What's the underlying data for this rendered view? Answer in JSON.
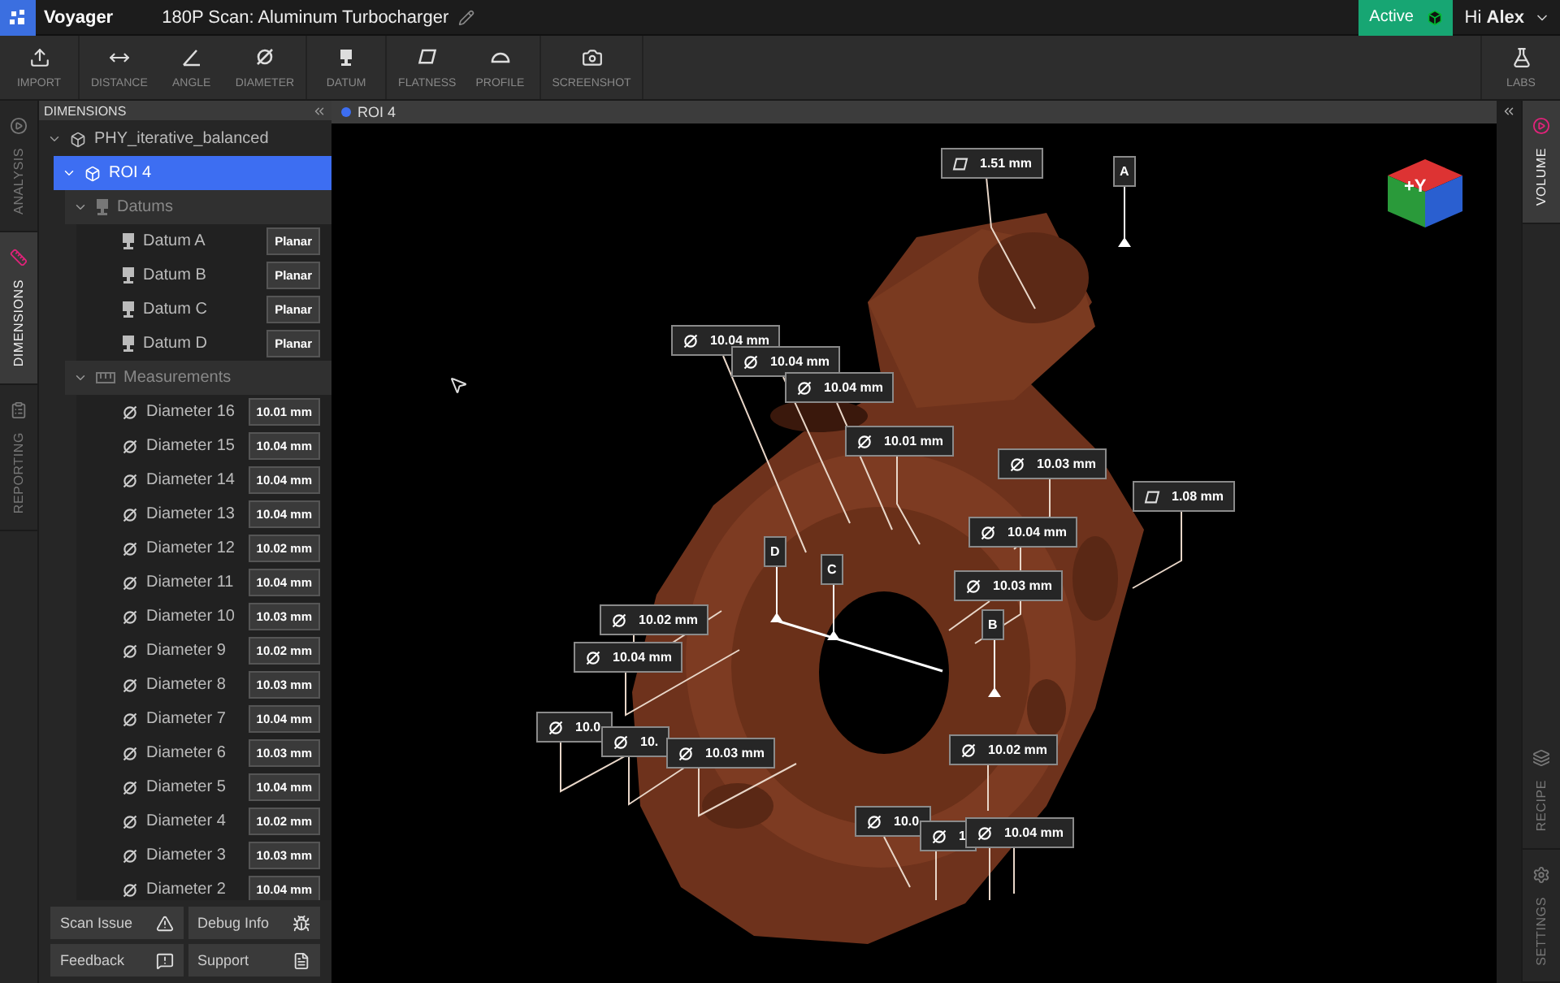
{
  "header": {
    "app_name": "Voyager",
    "title": "180P Scan: Aluminum Turbocharger",
    "status": "Active",
    "greeting": "Hi **Alex**"
  },
  "toolbar": {
    "groups": [
      [
        {
          "label": "IMPORT",
          "kind": "import"
        }
      ],
      [
        {
          "label": "DISTANCE",
          "kind": "distance"
        },
        {
          "label": "ANGLE",
          "kind": "angle"
        },
        {
          "label": "DIAMETER",
          "kind": "diameter"
        }
      ],
      [
        {
          "label": "DATUM",
          "kind": "datum"
        }
      ],
      [
        {
          "label": "FLATNESS",
          "kind": "flatness"
        },
        {
          "label": "PROFILE",
          "kind": "profile"
        }
      ],
      [
        {
          "label": "SCREENSHOT",
          "kind": "screenshot"
        }
      ]
    ],
    "right": {
      "label": "LABS",
      "kind": "labs"
    }
  },
  "left_tabs": [
    {
      "label": "ANALYSIS",
      "kind": "analysis",
      "selected": false
    },
    {
      "label": "DIMENSIONS",
      "kind": "dimensions",
      "selected": true
    },
    {
      "label": "REPORTING",
      "kind": "reporting",
      "selected": false
    }
  ],
  "panel": {
    "title": "DIMENSIONS",
    "tree": [
      {
        "label": "PHY_iterative_balanced",
        "kind": "root",
        "expanded": true,
        "selected": false,
        "children": [
          {
            "label": "ROI 4",
            "kind": "roi",
            "expanded": true,
            "selected": true,
            "children": [
              {
                "label": "Datums",
                "kind": "group",
                "expanded": true,
                "selected": false,
                "children": [
                  {
                    "label": "Datum A",
                    "kind": "datum",
                    "value": "Planar",
                    "selected": false
                  },
                  {
                    "label": "Datum B",
                    "kind": "datum",
                    "value": "Planar",
                    "selected": false
                  },
                  {
                    "label": "Datum C",
                    "kind": "datum",
                    "value": "Planar",
                    "selected": false
                  },
                  {
                    "label": "Datum D",
                    "kind": "datum",
                    "value": "Planar",
                    "selected": false
                  }
                ]
              },
              {
                "label": "Measurements",
                "kind": "group",
                "expanded": true,
                "selected": false,
                "children": [
                  {
                    "label": "Diameter 16",
                    "kind": "diameter",
                    "value": "10.01 mm",
                    "selected": false
                  },
                  {
                    "label": "Diameter 15",
                    "kind": "diameter",
                    "value": "10.04 mm",
                    "selected": false
                  },
                  {
                    "label": "Diameter 14",
                    "kind": "diameter",
                    "value": "10.04 mm",
                    "selected": false
                  },
                  {
                    "label": "Diameter 13",
                    "kind": "diameter",
                    "value": "10.04 mm",
                    "selected": false
                  },
                  {
                    "label": "Diameter 12",
                    "kind": "diameter",
                    "value": "10.02 mm",
                    "selected": false
                  },
                  {
                    "label": "Diameter 11",
                    "kind": "diameter",
                    "value": "10.04 mm",
                    "selected": false
                  },
                  {
                    "label": "Diameter 10",
                    "kind": "diameter",
                    "value": "10.03 mm",
                    "selected": false
                  },
                  {
                    "label": "Diameter 9",
                    "kind": "diameter",
                    "value": "10.02 mm",
                    "selected": false
                  },
                  {
                    "label": "Diameter 8",
                    "kind": "diameter",
                    "value": "10.03 mm",
                    "selected": false
                  },
                  {
                    "label": "Diameter 7",
                    "kind": "diameter",
                    "value": "10.04 mm",
                    "selected": false
                  },
                  {
                    "label": "Diameter 6",
                    "kind": "diameter",
                    "value": "10.03 mm",
                    "selected": false
                  },
                  {
                    "label": "Diameter 5",
                    "kind": "diameter",
                    "value": "10.04 mm",
                    "selected": false
                  },
                  {
                    "label": "Diameter 4",
                    "kind": "diameter",
                    "value": "10.02 mm",
                    "selected": false
                  },
                  {
                    "label": "Diameter 3",
                    "kind": "diameter",
                    "value": "10.03 mm",
                    "selected": false
                  },
                  {
                    "label": "Diameter 2",
                    "kind": "diameter",
                    "value": "10.04 mm",
                    "selected": false
                  }
                ]
              }
            ]
          }
        ]
      }
    ],
    "buttons": [
      {
        "label": "Scan Issue",
        "kind": "warning"
      },
      {
        "label": "Debug Info",
        "kind": "bug"
      },
      {
        "label": "Feedback",
        "kind": "feedback"
      },
      {
        "label": "Support",
        "kind": "document"
      }
    ]
  },
  "viewport": {
    "tab": "ROI 4",
    "cube_label": "+Y",
    "callouts": [
      {
        "kind": "flatness",
        "text": "1.51 mm"
      },
      {
        "kind": "datum",
        "text": "A"
      },
      {
        "kind": "diameter",
        "text": "10.04 mm"
      },
      {
        "kind": "diameter",
        "text": "10.04 mm"
      },
      {
        "kind": "diameter",
        "text": "10.04 mm"
      },
      {
        "kind": "diameter",
        "text": "10.01 mm"
      },
      {
        "kind": "diameter",
        "text": "10.03 mm"
      },
      {
        "kind": "flatness",
        "text": "1.08 mm"
      },
      {
        "kind": "diameter",
        "text": "10.04 mm"
      },
      {
        "kind": "datum",
        "text": "D"
      },
      {
        "kind": "datum",
        "text": "C"
      },
      {
        "kind": "diameter",
        "text": "10.03 mm"
      },
      {
        "kind": "datum",
        "text": "B"
      },
      {
        "kind": "diameter",
        "text": "10.02 mm"
      },
      {
        "kind": "diameter",
        "text": "10.04 mm"
      },
      {
        "kind": "diameter",
        "text": "10.0"
      },
      {
        "kind": "diameter",
        "text": "10."
      },
      {
        "kind": "diameter",
        "text": "10.03 mm"
      },
      {
        "kind": "diameter",
        "text": "10.02 mm"
      },
      {
        "kind": "diameter",
        "text": "10.0"
      },
      {
        "kind": "diameter",
        "text": "1"
      },
      {
        "kind": "diameter",
        "text": "10.04 mm"
      }
    ]
  },
  "right_tabs": [
    {
      "label": "VOLUME",
      "kind": "volume",
      "selected": true
    },
    {
      "label": "RECIPE",
      "kind": "recipe",
      "selected": false
    },
    {
      "label": "SETTINGS",
      "kind": "settings",
      "selected": false
    }
  ]
}
